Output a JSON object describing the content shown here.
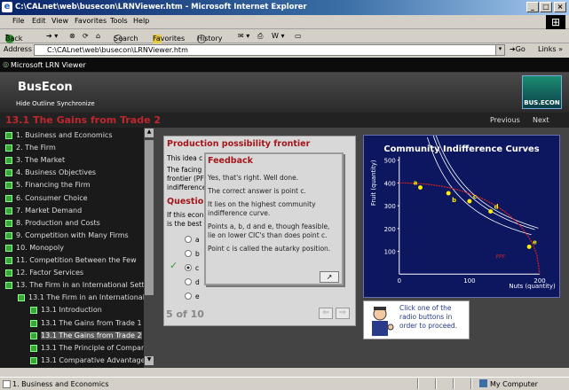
{
  "window": {
    "title": "C:\\CALnet\\web\\busecon\\LRNViewer.htm - Microsoft Internet Explorer"
  },
  "menu": [
    "File",
    "Edit",
    "View",
    "Favorites",
    "Tools",
    "Help"
  ],
  "toolbar": {
    "back": "Back",
    "search": "Search",
    "favorites": "Favorites",
    "history": "History"
  },
  "address": {
    "label": "Address",
    "value": "C:\\CALnet\\web\\busecon\\LRNViewer.htm",
    "go": "Go",
    "links": "Links"
  },
  "lrn": {
    "title": "Microsoft LRN Viewer"
  },
  "course": {
    "title": "BusEcon",
    "hide_outline": "Hide Outline",
    "synchronize": "Synchronize",
    "badge": "BUS.ECON"
  },
  "section": {
    "title": "13.1 The Gains from Trade 2",
    "previous": "Previous",
    "next": "Next"
  },
  "toc": [
    {
      "label": "1. Business and Economics"
    },
    {
      "label": "2. The Firm"
    },
    {
      "label": "3. The Market"
    },
    {
      "label": "4. Business Objectives"
    },
    {
      "label": "5. Financing the Firm"
    },
    {
      "label": "6. Consumer Choice"
    },
    {
      "label": "7. Market Demand"
    },
    {
      "label": "8. Production and Costs"
    },
    {
      "label": "9. Competition with Many Firms"
    },
    {
      "label": "10. Monopoly"
    },
    {
      "label": "11. Competition Between the Few"
    },
    {
      "label": "12. Factor Services"
    },
    {
      "label": "13. The Firm in an International Setti"
    },
    {
      "label": "13.1 The Firm in an International"
    },
    {
      "label": "13.1 Introduction"
    },
    {
      "label": "13.1 The Gains from Trade 1"
    },
    {
      "label": "13.1 The Gains from Trade 2"
    },
    {
      "label": "13.1 The Principle of Comparat"
    },
    {
      "label": "13.1 Comparative Advantage 1"
    }
  ],
  "question": {
    "panel_title": "Production possibility frontier",
    "intro1": "This idea c",
    "intro2": "The facing",
    "intro3": "frontier (PF",
    "intro4": "indifference",
    "heading": "Question",
    "q1": "If this econ",
    "q2": "is the best",
    "options": [
      "a",
      "b",
      "c",
      "d",
      "e"
    ],
    "counter": "5 of 10"
  },
  "feedback": {
    "title": "Feedback",
    "p1": "Yes, that's right. Well done.",
    "p2": "The correct answer is point c.",
    "p3a": "It lies on the highest community",
    "p3b": "indifference curve.",
    "p4a": "Points a, b, d and e, though feasible,",
    "p4b": "lie on lower CIC's than does point c.",
    "p5": "Point c is called the autarky position."
  },
  "chart_data": {
    "type": "line",
    "title": "Community Indifference Curves",
    "xlabel": "Nuts (quantity)",
    "ylabel": "Fruit (quantity)",
    "xlim": [
      0,
      200
    ],
    "ylim": [
      0,
      500
    ],
    "xticks": [
      "0",
      "100",
      "200"
    ],
    "yticks": [
      "100",
      "200",
      "300",
      "400",
      "500"
    ],
    "points": [
      {
        "label": "a",
        "x": 30,
        "y": 380
      },
      {
        "label": "b",
        "x": 70,
        "y": 355
      },
      {
        "label": "c",
        "x": 100,
        "y": 320
      },
      {
        "label": "d",
        "x": 130,
        "y": 275
      },
      {
        "label": "e",
        "x": 185,
        "y": 120
      }
    ],
    "ppf_label": "PPF",
    "colors": {
      "background": "#0d1760",
      "frontier": "#d62020",
      "curves": "#ffffff",
      "points": "#ffee00"
    }
  },
  "instruction": {
    "line1": "Click one of the",
    "line2": "radio buttons in",
    "line3": "order to proceed."
  },
  "status": {
    "left": "1. Business and Economics",
    "zone": "My Computer"
  }
}
